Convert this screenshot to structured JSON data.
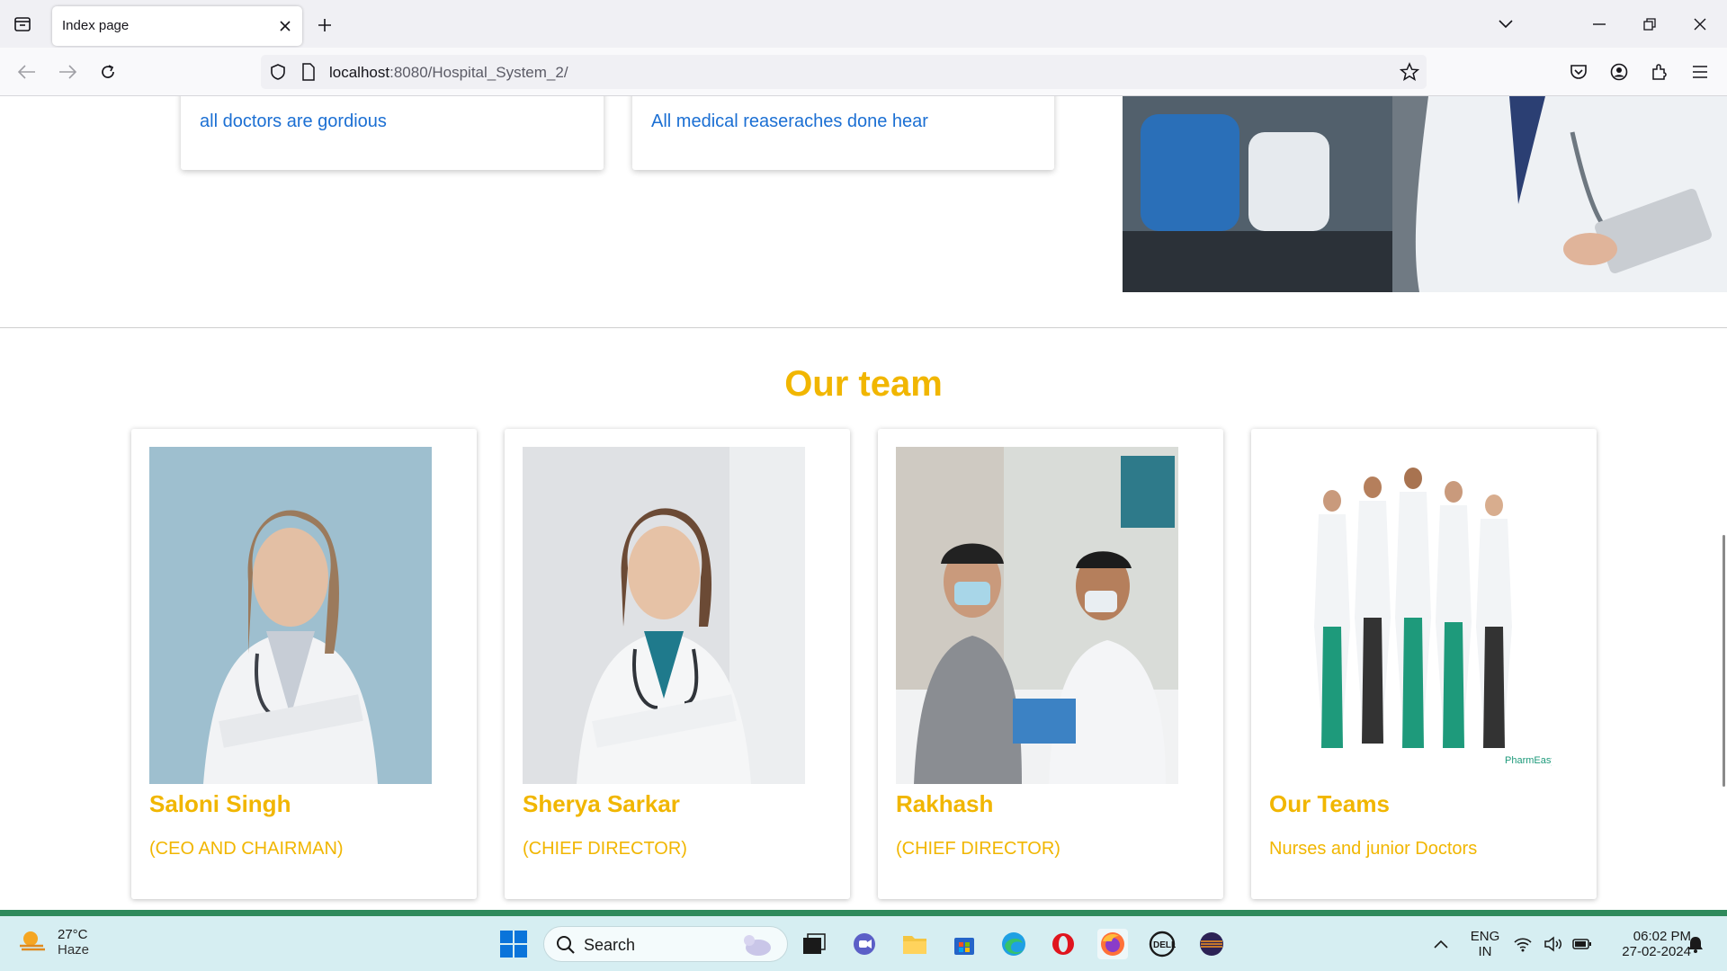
{
  "browser": {
    "tab_title": "Index page",
    "url_host": "localhost",
    "url_rest": ":8080/Hospital_System_2/"
  },
  "info_cards": [
    {
      "text": "all doctors are gordious"
    },
    {
      "text": "All medical reaseraches done hear"
    }
  ],
  "team": {
    "title": "Our team",
    "members": [
      {
        "name": "Saloni Singh",
        "role": "(CEO AND CHAIRMAN)"
      },
      {
        "name": "Sherya Sarkar",
        "role": "(CHIEF DIRECTOR)"
      },
      {
        "name": "Rakhash",
        "role": "(CHIEF DIRECTOR)"
      },
      {
        "name": "Our Teams",
        "role": "Nurses and junior Doctors"
      }
    ]
  },
  "taskbar": {
    "temperature": "27°C",
    "weather": "Haze",
    "search_placeholder": "Search",
    "lang": "ENG",
    "region": "IN",
    "time": "06:02 PM",
    "date": "27-02-2024"
  },
  "colors": {
    "accent_yellow": "#f1b600",
    "link_blue": "#1b6fd3",
    "taskbar_bg": "#d6eef2",
    "taskbar_border": "#2f8a5c"
  },
  "icons": [
    "tab-list-icon",
    "close-icon",
    "plus-icon",
    "chevron-down-icon",
    "minimize-icon",
    "restore-icon",
    "back-icon",
    "forward-icon",
    "reload-icon",
    "shield-icon",
    "page-icon",
    "star-icon",
    "pocket-icon",
    "account-icon",
    "extensions-icon",
    "menu-icon",
    "windows-start-icon",
    "search-icon",
    "weather-icon",
    "wifi-icon",
    "volume-icon",
    "battery-icon",
    "notification-icon"
  ]
}
